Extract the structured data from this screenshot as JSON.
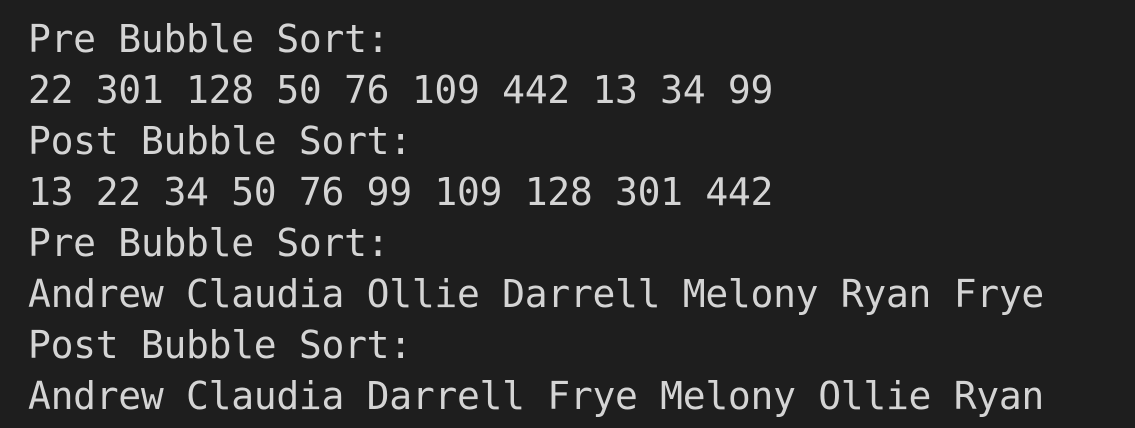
{
  "terminal": {
    "lines": [
      "Pre Bubble Sort:",
      "22 301 128 50 76 109 442 13 34 99",
      "Post Bubble Sort:",
      "13 22 34 50 76 99 109 128 301 442",
      "Pre Bubble Sort:",
      "Andrew Claudia Ollie Darrell Melony Ryan Frye",
      "Post Bubble Sort:",
      "Andrew Claudia Darrell Frye Melony Ollie Ryan"
    ]
  },
  "colors": {
    "background": "#1e1e1e",
    "text": "#d4d4d4"
  }
}
